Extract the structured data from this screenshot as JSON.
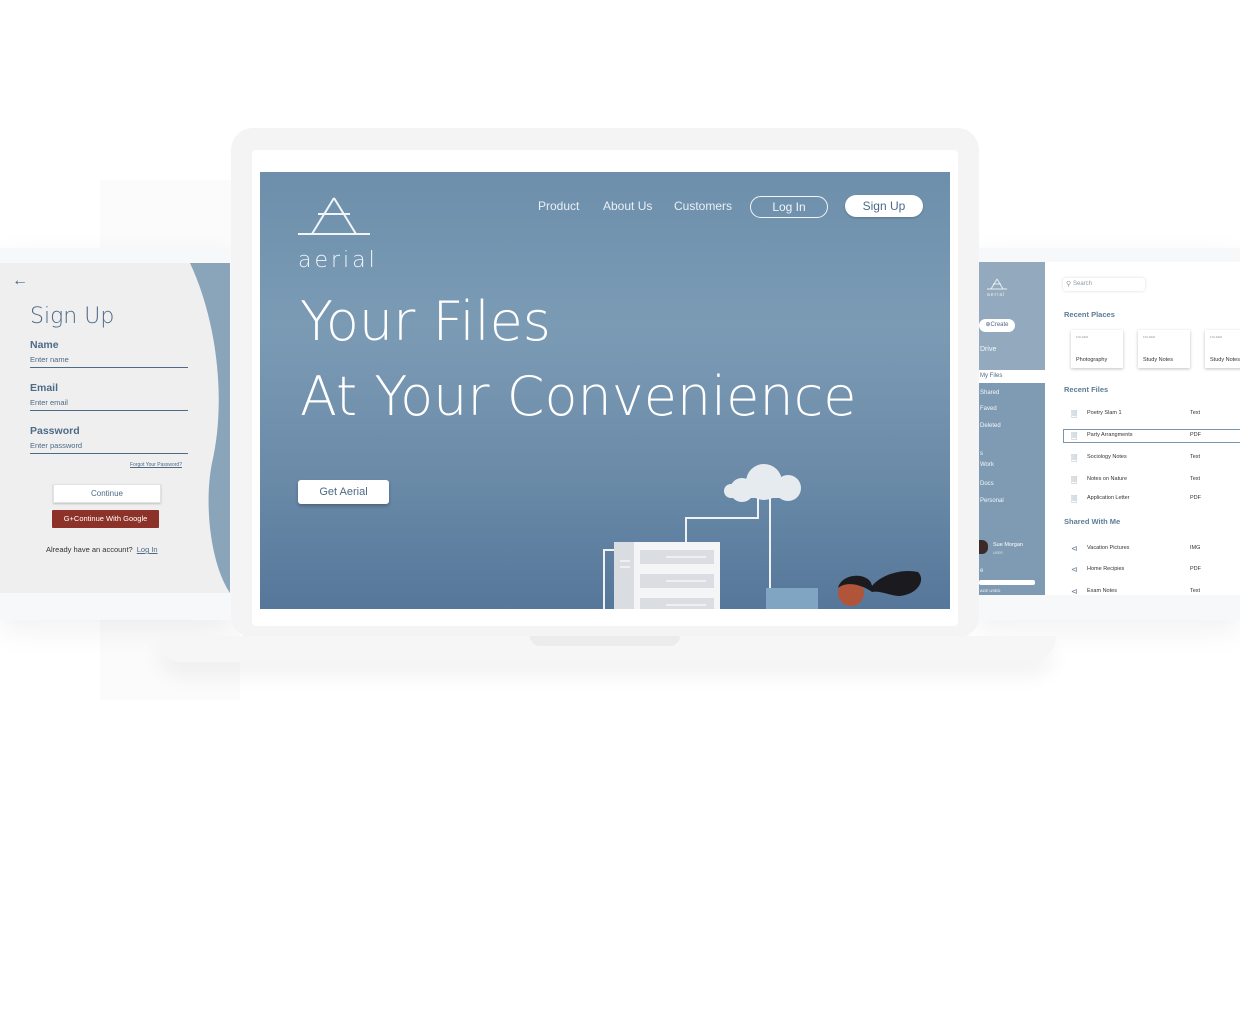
{
  "signup": {
    "title": "Sign Up",
    "name_label": "Name",
    "name_placeholder": "Enter name",
    "email_label": "Email",
    "email_placeholder": "Enter email",
    "password_label": "Password",
    "password_placeholder": "Enter password",
    "forgot": "Forgot Your Password?",
    "continue": "Continue",
    "google": "G+Continue With Google",
    "already": "Already have an account?",
    "login_link": "Log In"
  },
  "landing": {
    "brand": "aerial",
    "nav": [
      "Product",
      "About Us",
      "Customers"
    ],
    "login": "Log In",
    "signup": "Sign Up",
    "hero_line1": "Your Files",
    "hero_line2": "At Your Convenience",
    "cta": "Get Aerial"
  },
  "drive": {
    "brand": "aerial",
    "create": "⊕Create",
    "sidebar": [
      "Drive",
      "My Files",
      "Shared",
      "Faved",
      "Deleted",
      "Work",
      "Docs",
      "Personal"
    ],
    "sidebar_partial": "s",
    "user_name": "Sue Morgan",
    "user_sub": "USER",
    "storage_partial": "e",
    "storage_label": "ACE USED",
    "search_placeholder": "Search",
    "recent_places_title": "Recent Places",
    "folders": [
      {
        "tag": "FOLDER",
        "name": "Photography"
      },
      {
        "tag": "FOLDER",
        "name": "Study Notes"
      },
      {
        "tag": "FOLDER",
        "name": "Study Notes"
      }
    ],
    "recent_files_title": "Recent Files",
    "recent_files": [
      {
        "name": "Poetry Slam 1",
        "type": "Text"
      },
      {
        "name": "Party Arrangments",
        "type": "PDF"
      },
      {
        "name": "Sociology Notes",
        "type": "Text"
      },
      {
        "name": "Notes on Nature",
        "type": "Text"
      },
      {
        "name": "Application Letter",
        "type": "PDF"
      }
    ],
    "shared_title": "Shared With Me",
    "shared_files": [
      {
        "name": "Vacation Pictures",
        "type": "IMG"
      },
      {
        "name": "Home Recipies",
        "type": "PDF"
      },
      {
        "name": "Exam Notes",
        "type": "Text"
      }
    ]
  },
  "colors": {
    "accent": "#4d6a86",
    "hero_bg": "#6d8fab",
    "google_red": "#8c3229",
    "drive_sidebar": "#7f9bb3"
  }
}
